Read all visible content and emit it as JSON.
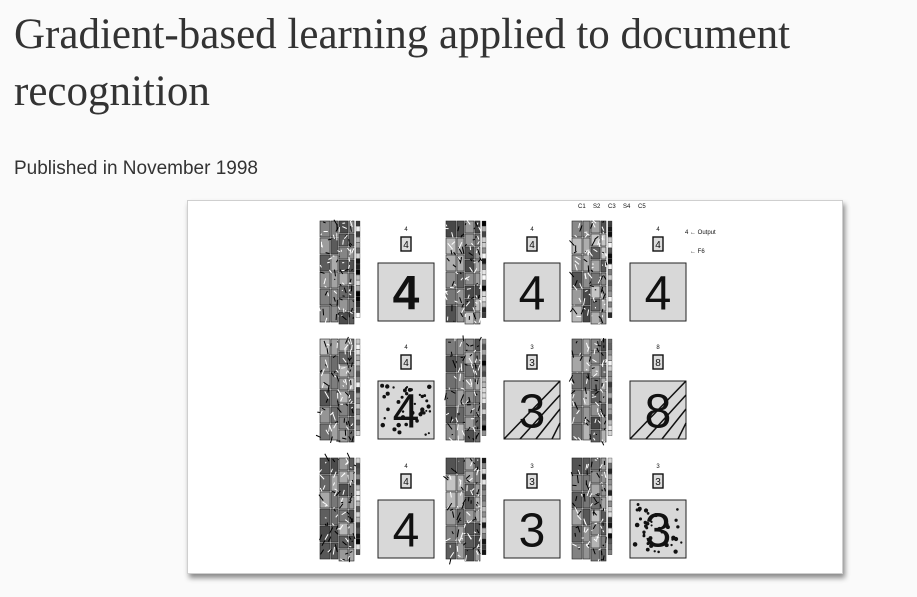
{
  "paper": {
    "title": "Gradient-based learning applied to document recognition",
    "published": "Published in November 1998"
  },
  "figure": {
    "layer_labels": [
      "C1",
      "S2",
      "C3",
      "S4",
      "C5"
    ],
    "output_label": "Output",
    "f6_label": "F6",
    "panels": [
      {
        "output": "4",
        "input_digit": "4"
      },
      {
        "output": "4",
        "input_digit": "4"
      },
      {
        "output": "4",
        "input_digit": "4"
      },
      {
        "output": "4",
        "input_digit": "4"
      },
      {
        "output": "3",
        "input_digit": "3"
      },
      {
        "output": "8",
        "input_digit": "8"
      },
      {
        "output": "4",
        "input_digit": "4"
      },
      {
        "output": "3",
        "input_digit": "3"
      },
      {
        "output": "3",
        "input_digit": "3"
      }
    ]
  }
}
